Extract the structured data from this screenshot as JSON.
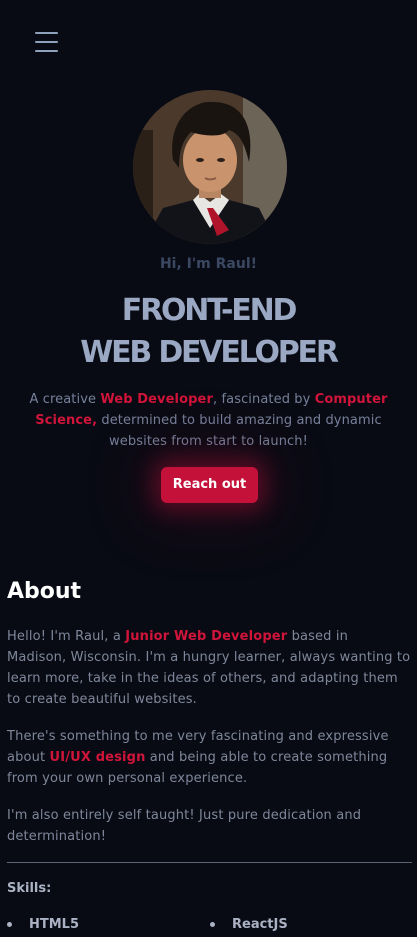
{
  "nav": {
    "menu_icon": "hamburger-menu-icon"
  },
  "hero": {
    "avatar_alt": "profile photo",
    "greeting": "Hi, I'm Raul!",
    "headline_line1": "FRONT-END",
    "headline_line2": "WEB DEVELOPER",
    "intro": {
      "part1": "A creative ",
      "accent1": "Web Developer",
      "part2": ", fascinated by ",
      "accent2": "Computer Science,",
      "part3": " determined to build amazing and dynamic websites from start to launch!"
    },
    "cta_label": "Reach out"
  },
  "about": {
    "title": "About",
    "p1": {
      "part1": "Hello! I'm Raul, a ",
      "accent": "Junior Web Developer",
      "part2": " based in Madison, Wisconsin. I'm a hungry learner, always wanting to learn more, take in the ideas of others, and adapting them to create beautiful websites."
    },
    "p2": {
      "part1": "There's something to me very fascinating and expressive about ",
      "accent": "UI/UX design",
      "part2": " and being able to create something from your own personal experience."
    },
    "p3": "I'm also entirely self taught! Just pure dedication and determination!",
    "skills_title": "Skills:",
    "skills": [
      "HTML5",
      "ReactJS"
    ]
  },
  "colors": {
    "background": "#090b14",
    "accent": "#c4113a",
    "headline": "#9aa8c3"
  }
}
